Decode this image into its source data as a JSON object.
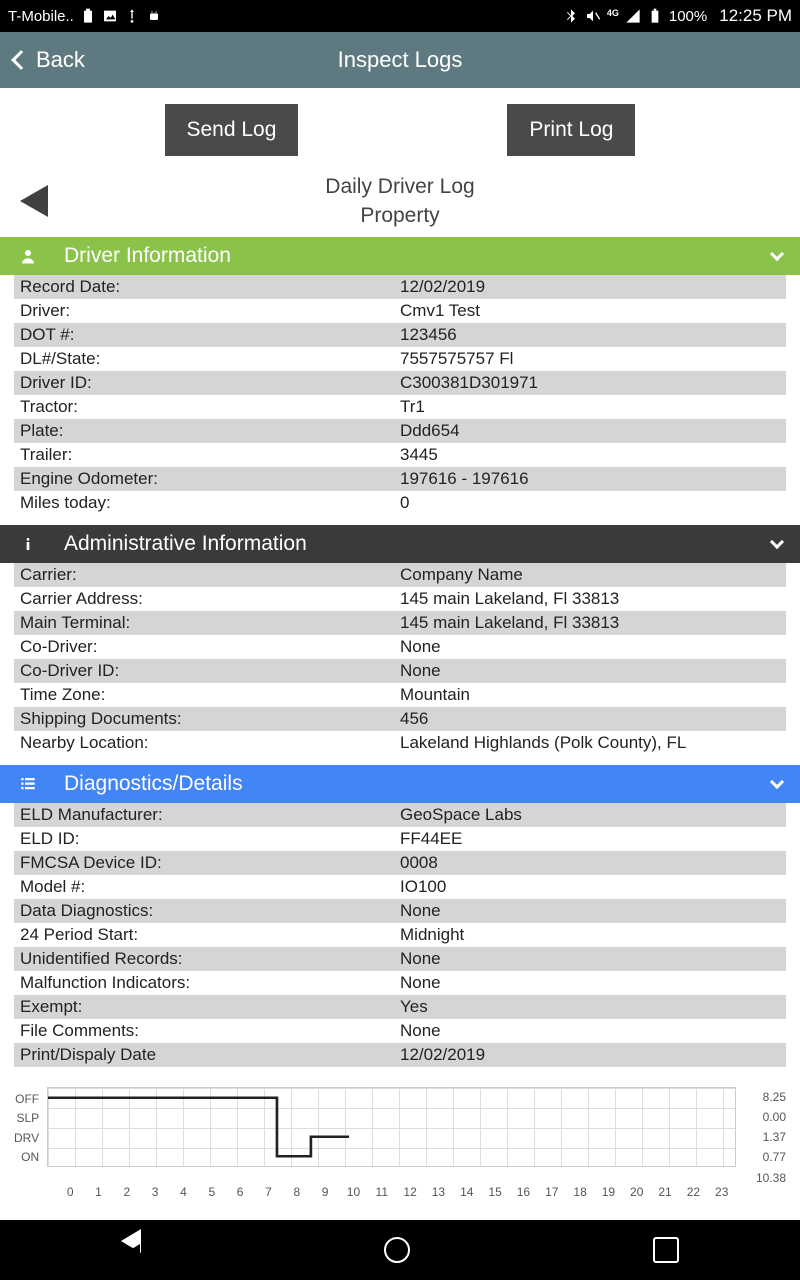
{
  "status": {
    "carrier": "T-Mobile..",
    "battery": "100%",
    "time": "12:25 PM"
  },
  "header": {
    "back": "Back",
    "title": "Inspect Logs"
  },
  "actions": {
    "send": "Send Log",
    "print": "Print Log"
  },
  "doc_title": {
    "line1": "Daily Driver Log",
    "line2": "Property"
  },
  "sections": {
    "driver": {
      "heading": "Driver Information",
      "rows": [
        {
          "label": "Record Date:",
          "value": "12/02/2019"
        },
        {
          "label": "Driver:",
          "value": "Cmv1 Test"
        },
        {
          "label": "DOT #:",
          "value": "123456"
        },
        {
          "label": "DL#/State:",
          "value": "7557575757 Fl"
        },
        {
          "label": "Driver ID:",
          "value": "C300381D301971"
        },
        {
          "label": "Tractor:",
          "value": "Tr1"
        },
        {
          "label": "Plate:",
          "value": "Ddd654"
        },
        {
          "label": "Trailer:",
          "value": "3445"
        },
        {
          "label": "Engine Odometer:",
          "value": "197616 - 197616"
        },
        {
          "label": "Miles today:",
          "value": "0"
        }
      ]
    },
    "admin": {
      "heading": "Administrative Information",
      "rows": [
        {
          "label": "Carrier:",
          "value": "Company Name"
        },
        {
          "label": "Carrier Address:",
          "value": "145 main Lakeland, Fl 33813"
        },
        {
          "label": "Main Terminal:",
          "value": "145 main Lakeland, Fl 33813"
        },
        {
          "label": "Co-Driver:",
          "value": "None"
        },
        {
          "label": "Co-Driver ID:",
          "value": "None"
        },
        {
          "label": "Time Zone:",
          "value": "Mountain"
        },
        {
          "label": "Shipping Documents:",
          "value": "456"
        },
        {
          "label": "Nearby Location:",
          "value": "Lakeland Highlands (Polk County), FL"
        }
      ]
    },
    "diag": {
      "heading": "Diagnostics/Details",
      "rows": [
        {
          "label": "ELD Manufacturer:",
          "value": "GeoSpace Labs"
        },
        {
          "label": "ELD ID:",
          "value": "FF44EE"
        },
        {
          "label": "FMCSA Device ID:",
          "value": "0008"
        },
        {
          "label": "Model #:",
          "value": "IO100"
        },
        {
          "label": "Data Diagnostics:",
          "value": "None"
        },
        {
          "label": "24 Period Start:",
          "value": "Midnight"
        },
        {
          "label": "Unidentified Records:",
          "value": "None"
        },
        {
          "label": "Malfunction Indicators:",
          "value": "None"
        },
        {
          "label": "Exempt:",
          "value": "Yes"
        },
        {
          "label": "File Comments:",
          "value": "None"
        },
        {
          "label": "Print/Dispaly Date",
          "value": "12/02/2019"
        }
      ]
    }
  },
  "chart_data": {
    "type": "line",
    "y_categories": [
      "OFF",
      "SLP",
      "DRV",
      "ON"
    ],
    "x_hours": [
      "0",
      "1",
      "2",
      "3",
      "4",
      "5",
      "6",
      "7",
      "8",
      "9",
      "10",
      "11",
      "12",
      "13",
      "14",
      "15",
      "16",
      "17",
      "18",
      "19",
      "20",
      "21",
      "22",
      "23"
    ],
    "segments": [
      {
        "state": "OFF",
        "from": 0,
        "to": 8
      },
      {
        "state": "ON",
        "from": 8,
        "to": 9.2
      },
      {
        "state": "DRV",
        "from": 9.2,
        "to": 10.5
      }
    ],
    "totals": {
      "OFF": "8.25",
      "SLP": "0.00",
      "DRV": "1.37",
      "ON": "0.77"
    },
    "grand_total": "10.38"
  }
}
